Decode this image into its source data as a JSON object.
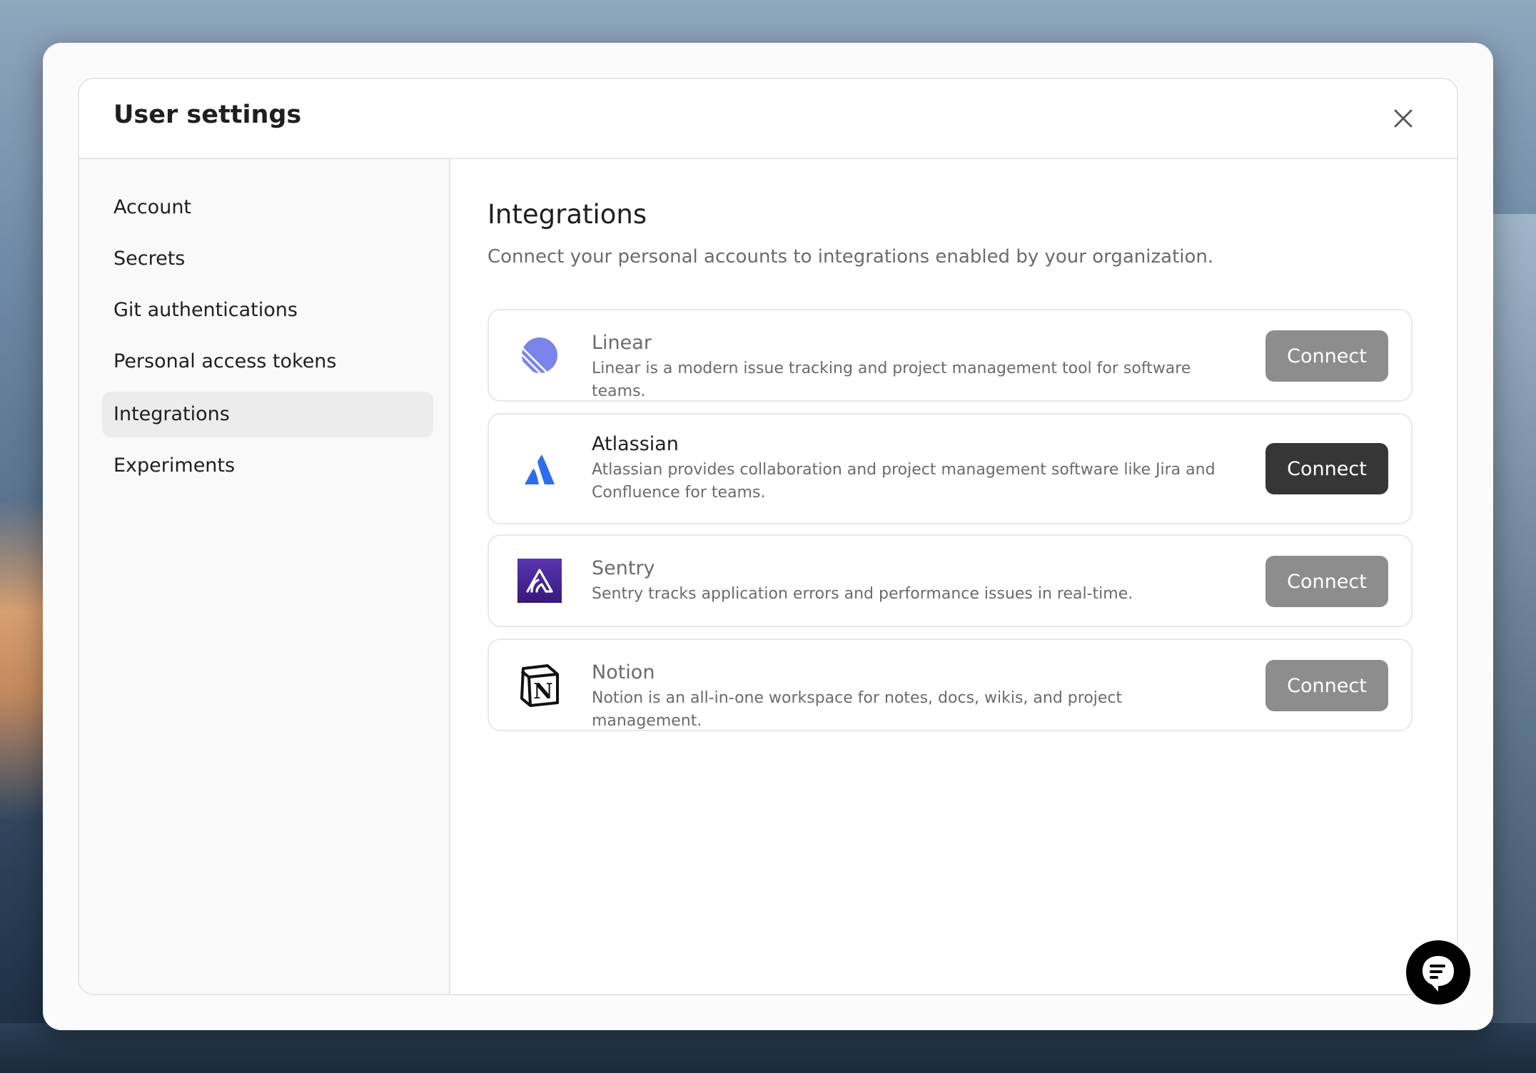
{
  "modal": {
    "title": "User settings"
  },
  "sidebar": {
    "items": [
      {
        "label": "Account",
        "active": false
      },
      {
        "label": "Secrets",
        "active": false
      },
      {
        "label": "Git authentications",
        "active": false
      },
      {
        "label": "Personal access tokens",
        "active": false
      },
      {
        "label": "Integrations",
        "active": true
      },
      {
        "label": "Experiments",
        "active": false
      }
    ]
  },
  "main": {
    "title": "Integrations",
    "subtitle": "Connect your personal accounts to integrations enabled by your organization.",
    "integrations": [
      {
        "name": "Linear",
        "description": "Linear is a modern issue tracking and project management tool for software teams.",
        "button": "Connect",
        "icon": "linear-logo-icon"
      },
      {
        "name": "Atlassian",
        "description": "Atlassian provides collaboration and project management software like Jira and Confluence for teams.",
        "button": "Connect",
        "icon": "atlassian-logo-icon"
      },
      {
        "name": "Sentry",
        "description": "Sentry tracks application errors and performance issues in real-time.",
        "button": "Connect",
        "icon": "sentry-logo-icon"
      },
      {
        "name": "Notion",
        "description": "Notion is an all-in-one workspace for notes, docs, wikis, and project management.",
        "button": "Connect",
        "icon": "notion-logo-icon"
      }
    ]
  },
  "colors": {
    "linear": "#7b83eb",
    "atlassian": "#2f6bf0",
    "sentry": "#4a2a92",
    "button_disabled": "#8d8d8d",
    "button_active": "#363636"
  }
}
